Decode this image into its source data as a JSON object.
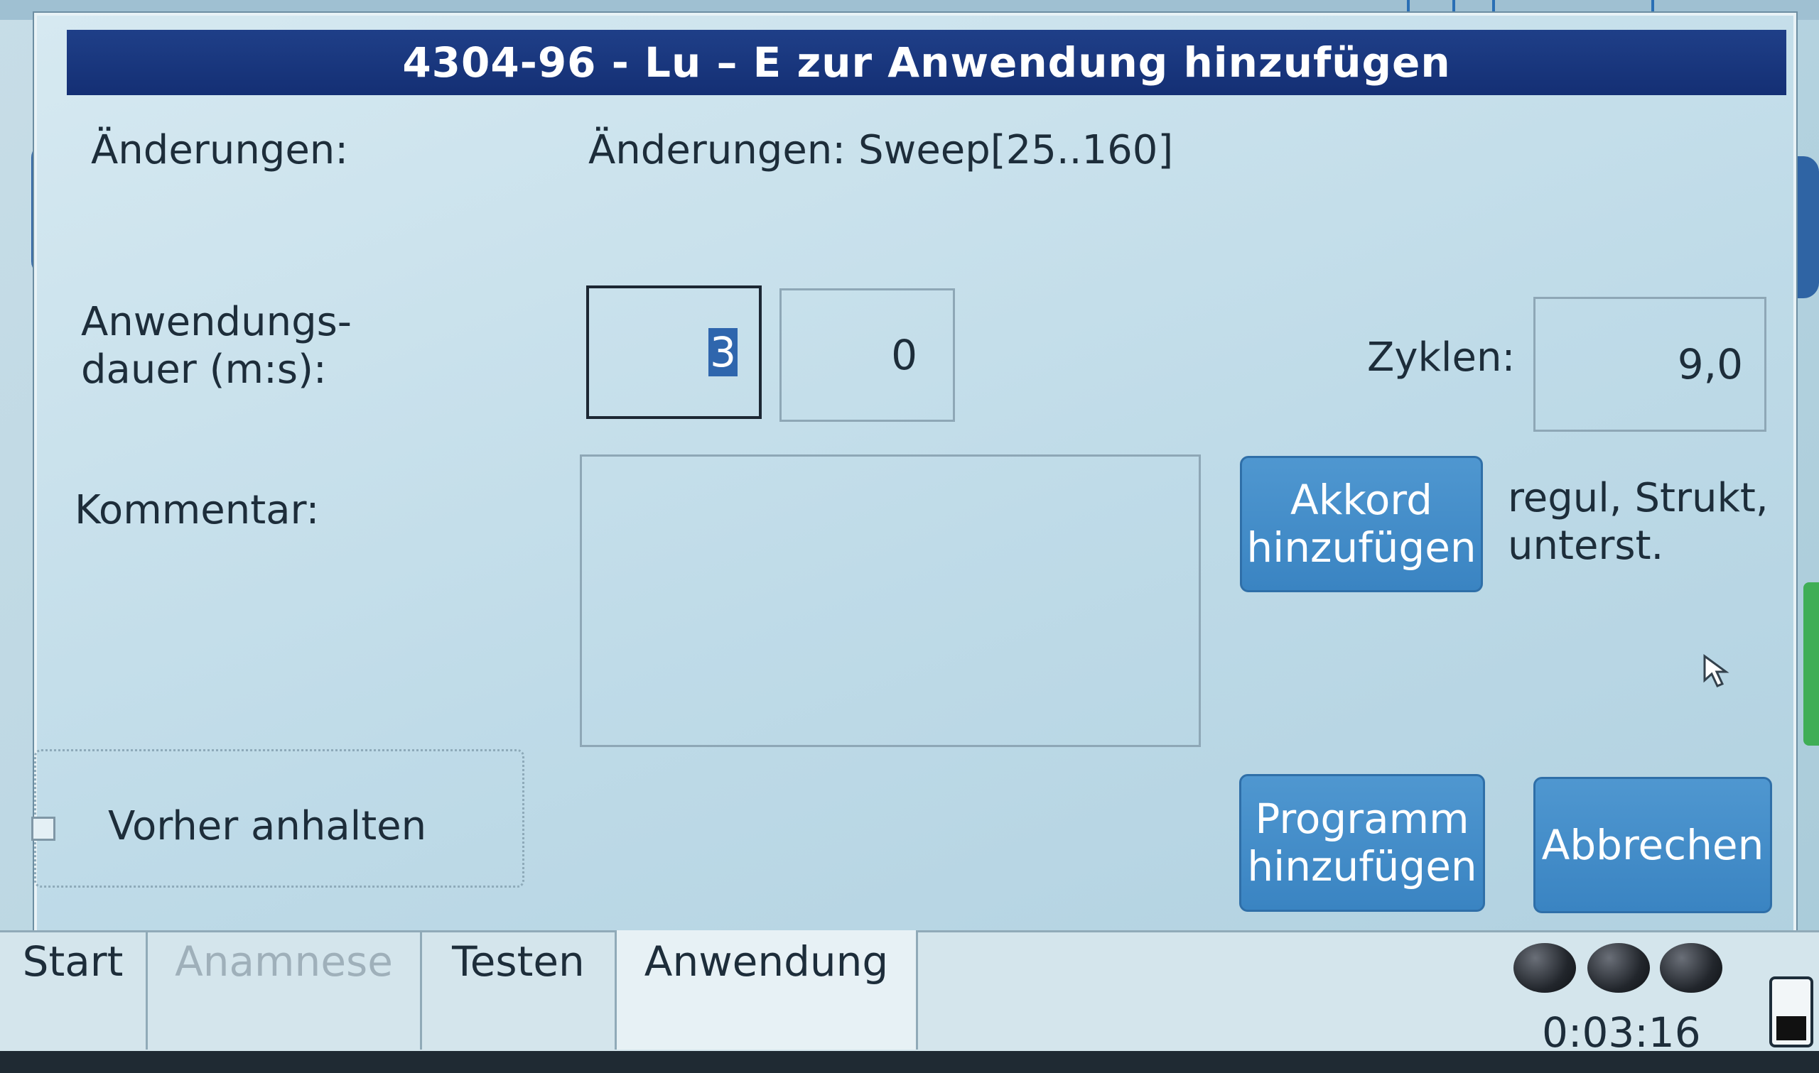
{
  "dialog": {
    "title": "4304-96 - Lu – E zur Anwendung hinzufügen",
    "changes_label": "Änderungen:",
    "changes_value": "Änderungen: Sweep[25..160]",
    "duration_label_line1": "Anwendungs-",
    "duration_label_line2": "dauer (m:s):",
    "duration_minutes": "3",
    "duration_seconds": "0",
    "cycles_label": "Zyklen:",
    "cycles_value": "9,0",
    "comment_label": "Kommentar:",
    "comment_value": "",
    "chord_button_line1": "Akkord",
    "chord_button_line2": "hinzufügen",
    "chord_info_line1": "regul, Strukt,",
    "chord_info_line2": "unterst.",
    "pause_checkbox_label": "Vorher anhalten",
    "pause_checkbox_checked": false,
    "add_program_line1": "Programm",
    "add_program_line2": "hinzufügen",
    "cancel_button": "Abbrechen"
  },
  "tabs": [
    {
      "label": "Start",
      "state": "normal"
    },
    {
      "label": "Anamnese",
      "state": "disabled"
    },
    {
      "label": "Testen",
      "state": "normal"
    },
    {
      "label": "Anwendung",
      "state": "active"
    }
  ],
  "status": {
    "timer": "0:03:16",
    "indicator_count": 3
  },
  "colors": {
    "title_bar": "#142f74",
    "button": "#3a84c2",
    "background": "#bfdbe8"
  }
}
